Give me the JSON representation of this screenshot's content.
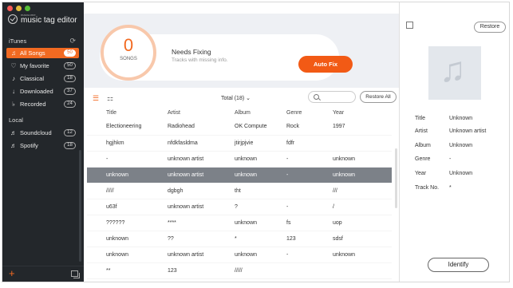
{
  "app": {
    "logo_small": "macsome",
    "logo_name": "music tag editor"
  },
  "traffic_lights": [
    "#fc5b57",
    "#e5bf3c",
    "#57c038"
  ],
  "sidebar": {
    "itunes_title": "iTunes",
    "items": [
      {
        "icon": "music-note-icon",
        "glyph": "♫",
        "label": "All Songs",
        "count": "50",
        "active": true
      },
      {
        "icon": "heart-icon",
        "glyph": "♡",
        "label": "My favorite",
        "count": "50"
      },
      {
        "icon": "violin-icon",
        "glyph": "♪",
        "label": "Classical",
        "count": "18"
      },
      {
        "icon": "download-icon",
        "glyph": "↓",
        "label": "Downloaded",
        "count": "37"
      },
      {
        "icon": "microphone-icon",
        "glyph": "♭",
        "label": "Recorded",
        "count": "24"
      }
    ],
    "local_title": "Local",
    "local_items": [
      {
        "icon": "soundcloud-icon",
        "glyph": "♬",
        "label": "Soundcloud",
        "count": "12"
      },
      {
        "icon": "spotify-icon",
        "glyph": "♬",
        "label": "Spotify",
        "count": "18"
      }
    ]
  },
  "hero": {
    "count": "0",
    "count_label": "SONGS",
    "title": "Needs Fixing",
    "subtitle": "Tracks with missing info.",
    "auto_fix": "Auto Fix"
  },
  "toolbar": {
    "total": "Total (18) ⌄",
    "restore_all": "Restore All"
  },
  "table": {
    "columns": [
      "Title",
      "Artist",
      "Album",
      "Genre",
      "Year"
    ],
    "rows": [
      [
        "Electioneering",
        "Radiohead",
        "OK Computer",
        "Rock",
        "1997"
      ],
      [
        "hgjhkm",
        "nfdkfasldma",
        "jtirjpjvie",
        "fdfr",
        ""
      ],
      [
        "-",
        "unknown artist",
        "unknown",
        "-",
        "unknown"
      ],
      [
        "unknown",
        "unknown artist",
        "unknown",
        "-",
        "unknown"
      ],
      [
        "/////",
        "dgbgh",
        "tht",
        "",
        "///"
      ],
      [
        "u63f",
        "unknown artist",
        "?",
        "-",
        "/"
      ],
      [
        "??????",
        "****",
        "unknown",
        "fs",
        "uop"
      ],
      [
        "unknown",
        "??",
        "*",
        "123",
        "sdsf"
      ],
      [
        "unknown",
        "unknown artist",
        "unknown",
        "-",
        "unknown"
      ],
      [
        "**",
        "123",
        "/////",
        "",
        ""
      ]
    ],
    "selected_index": 3
  },
  "panel": {
    "restore": "Restore",
    "fields": [
      {
        "key": "Title",
        "value": "Unknown"
      },
      {
        "key": "Artist",
        "value": "Unknown artist"
      },
      {
        "key": "Album",
        "value": "Unknown"
      },
      {
        "key": "Genre",
        "value": "-"
      },
      {
        "key": "Year",
        "value": "Unknown"
      },
      {
        "key": "Track No.",
        "value": "*"
      }
    ],
    "identify": "Identify"
  }
}
